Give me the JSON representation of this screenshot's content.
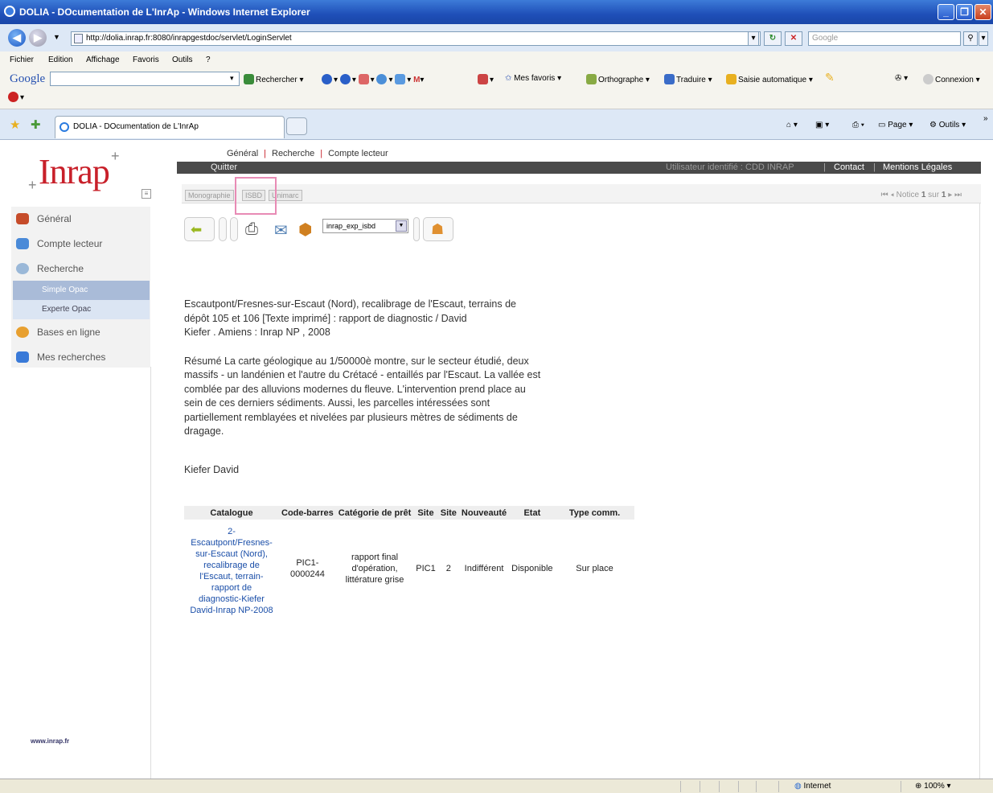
{
  "window": {
    "title": "DOLIA - DOcumentation de L'InrAp - Windows Internet Explorer"
  },
  "address": {
    "url": "http://dolia.inrap.fr:8080/inrapgestdoc/servlet/LoginServlet",
    "search_placeholder": "Google"
  },
  "menu": [
    "Fichier",
    "Edition",
    "Affichage",
    "Favoris",
    "Outils",
    "?"
  ],
  "gtoolbar": {
    "logo": "Google",
    "search": "Rechercher",
    "favorites": "Mes favoris",
    "spelling": "Orthographe",
    "translate": "Traduire",
    "autofill": "Saisie automatique",
    "login": "Connexion"
  },
  "tabs": {
    "active": "DOLIA - DOcumentation de L'InrAp",
    "page_menu": "Page",
    "tools_menu": "Outils"
  },
  "site": {
    "logo": "Inrap",
    "topnav": [
      "Général",
      "Recherche",
      "Compte lecteur"
    ],
    "quit": "Quitter",
    "user": "Utilisateur identifié : CDD INRAP",
    "contact": "Contact",
    "legal": "Mentions Légales",
    "formats": [
      "Monographie",
      "ISBD",
      "Unimarc"
    ],
    "notice_nav": {
      "label": "Notice",
      "current": "1",
      "of": "sur",
      "total": "1"
    },
    "export_select": "inrap_exp_isbd",
    "weblink": "www.inrap.fr"
  },
  "sidebar": {
    "items": [
      "Général",
      "Compte lecteur",
      "Recherche",
      "Bases en ligne",
      "Mes recherches"
    ],
    "sub": [
      "Simple Opac",
      "Experte Opac"
    ]
  },
  "record": {
    "citation": "Escautpont/Fresnes-sur-Escaut (Nord), recalibrage de l'Escaut, terrains de\ndépôt 105 et 106 [Texte imprimé] : rapport de diagnostic / David\nKiefer . Amiens : Inrap NP , 2008",
    "abstract": "Résumé La carte géologique au 1/50000è montre, sur le secteur étudié, deux\nmassifs - un landénien et l'autre du Crétacé - entaillés par l'Escaut. La vallée est\ncomblée par des alluvions modernes du fleuve. L'intervention prend place au\nsein de ces derniers sédiments. Aussi, les parcelles intéressées sont\npartiellement remblayées et nivelées par plusieurs mètres de sédiments de\ndragage.",
    "author": "Kiefer David"
  },
  "copies": {
    "headers": [
      "Catalogue",
      "Code-barres",
      "Catégorie de prêt",
      "Site",
      "Site",
      "Nouveauté",
      "Etat",
      "Type comm."
    ],
    "row": [
      "2-\nEscautpont/Fresnes-\nsur-Escaut (Nord),\nrecalibrage de\nl'Escaut, terrain-\nrapport de\ndiagnostic-Kiefer\nDavid-Inrap NP-2008",
      "PIC1-\n0000244",
      "rapport final\nd'opération,\nlittérature grise",
      "PIC1",
      "2",
      "Indifférent",
      "Disponible",
      "Sur place"
    ]
  },
  "status": {
    "zone": "Internet",
    "zoom": "100%"
  }
}
